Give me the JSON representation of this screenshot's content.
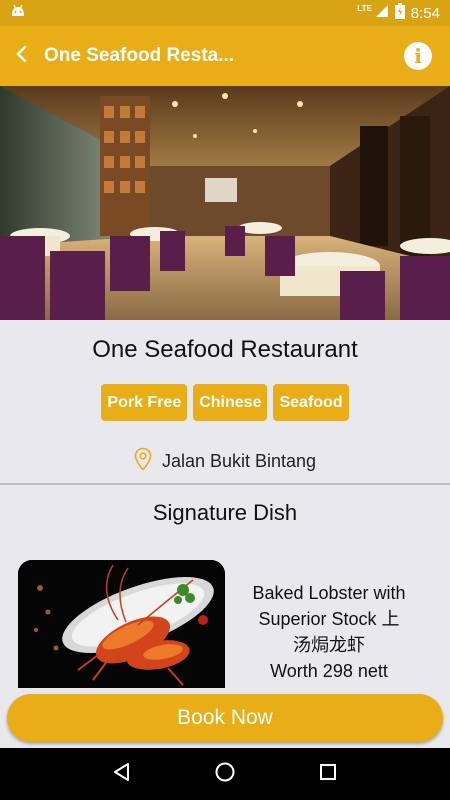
{
  "status_bar": {
    "time": "8:54",
    "network": "LTE",
    "icons": [
      "android-icon",
      "signal-icon",
      "battery-icon"
    ]
  },
  "app_bar": {
    "title": "One Seafood Resta...",
    "back_icon": "arrow-back-icon",
    "info_icon": "info-icon",
    "info_glyph": "i"
  },
  "restaurant": {
    "name": "One Seafood Restaurant",
    "tags": [
      "Pork Free",
      "Chinese",
      "Seafood"
    ],
    "location": "Jalan Bukit Bintang",
    "location_icon": "map-pin-icon"
  },
  "signature": {
    "heading": "Signature Dish",
    "dish_name_line1": "Baked Lobster with",
    "dish_name_line2": "Superior Stock 上",
    "dish_name_line3": "汤焗龙虾",
    "price": "Worth 298 nett"
  },
  "actions": {
    "book_label": "Book Now"
  },
  "colors": {
    "accent": "#e9ad18",
    "status_bar": "#d8a416",
    "background": "#e9e8ec"
  },
  "nav": {
    "icons": [
      "back-triangle-icon",
      "home-circle-icon",
      "recents-square-icon"
    ]
  }
}
